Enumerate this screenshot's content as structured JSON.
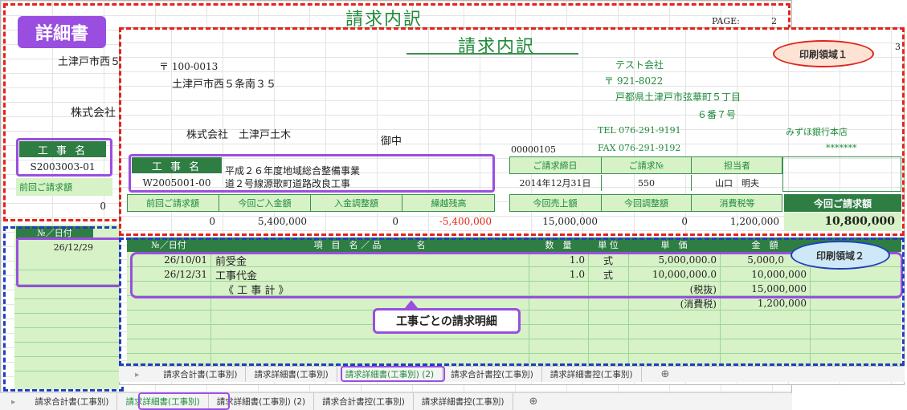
{
  "callouts": {
    "detail_label": "詳細書",
    "print_area_1": "印刷領域１",
    "print_area_2": "印刷領域２",
    "per_job": "工事ごとの請求明細"
  },
  "back_sheet": {
    "title": "請求内訳",
    "page_label": "PAGE:",
    "page_num": "2",
    "address": "土津戸市西５",
    "company": "株式会社",
    "job_label": "工 事 名",
    "job_code": "S2003003-01",
    "prev_label": "前回ご請求額",
    "prev_value": "0",
    "col_no_date": "№／日付",
    "row_date": "26/12/29",
    "tabs": [
      "請求合計書(工事別)",
      "請求詳細書(工事別)",
      "請求詳細書(工事別) (2)",
      "請求合計書控(工事別)",
      "請求詳細書控(工事別)"
    ]
  },
  "front_sheet": {
    "title": "請求内訳",
    "page_num": "3",
    "postal": "〒 100-0013",
    "address": "土津戸市西５条南３５",
    "client": "株式会社　土津戸土木",
    "honorific": "御中",
    "doc_no": "00000105",
    "sender_company": "テスト会社",
    "sender_postal": "〒 921-8022",
    "sender_address1": "戸都県土津戸市弦華町５丁目",
    "sender_address2": "６番７号",
    "tel": "TEL 076-291-9191",
    "fax": "FAX 076-291-9192",
    "bank": "みずほ銀行本店",
    "account": "*******",
    "job_label": "工 事 名",
    "job_code": "W2005001-00",
    "job_name1": "平成２６年度地域総合整備事業",
    "job_name2": "道２号線源歌町道路改良工事",
    "info_headers": [
      "ご請求締日",
      "ご請求№",
      "担当者"
    ],
    "info_values": [
      "2014年12月31日",
      "550",
      "山口　明夫"
    ],
    "summary_headers": [
      "前回ご請求額",
      "今回ご入金額",
      "入金調整額",
      "繰越残高",
      "今回売上額",
      "今回調整額",
      "消費税等",
      "今回ご請求額"
    ],
    "summary_values": [
      "0",
      "5,400,000",
      "0",
      "-5,400,000",
      "15,000,000",
      "0",
      "1,200,000",
      "10,800,000"
    ],
    "detail_headers": [
      "№／日付",
      "項　目　名 ／ 品　　　　名",
      "数　量",
      "単 位",
      "単　価",
      "金　額"
    ],
    "rows": [
      {
        "date": "26/10/01",
        "item": "前受金",
        "qty": "1.0",
        "unit": "式",
        "price": "5,000,000.0",
        "amount": "5,000,0"
      },
      {
        "date": "26/12/31",
        "item": "工事代金",
        "qty": "1.0",
        "unit": "式",
        "price": "10,000,000.0",
        "amount": "10,000,000"
      },
      {
        "date": "",
        "item": "《 工 事 計 》",
        "qty": "",
        "unit": "",
        "price": "(税抜)",
        "amount": "15,000,000"
      },
      {
        "date": "",
        "item": "",
        "qty": "",
        "unit": "",
        "price": "(消費税)",
        "amount": "1,200,000"
      }
    ],
    "tabs": [
      "請求合計書(工事別)",
      "請求詳細書(工事別)",
      "請求詳細書(工事別) (2)",
      "請求合計書控(工事別)",
      "請求詳細書控(工事別)"
    ]
  },
  "colors": {
    "dark_green": "#2e7d43",
    "light_green": "#d6f2c6",
    "red_dash": "#e2231a",
    "blue_dash": "#1f3fbf",
    "purple": "#9a4ee0",
    "negative": "#e2231a"
  },
  "icons": {
    "add_sheet": "plus-circle-icon",
    "scroll": "chevron-right-icon"
  }
}
